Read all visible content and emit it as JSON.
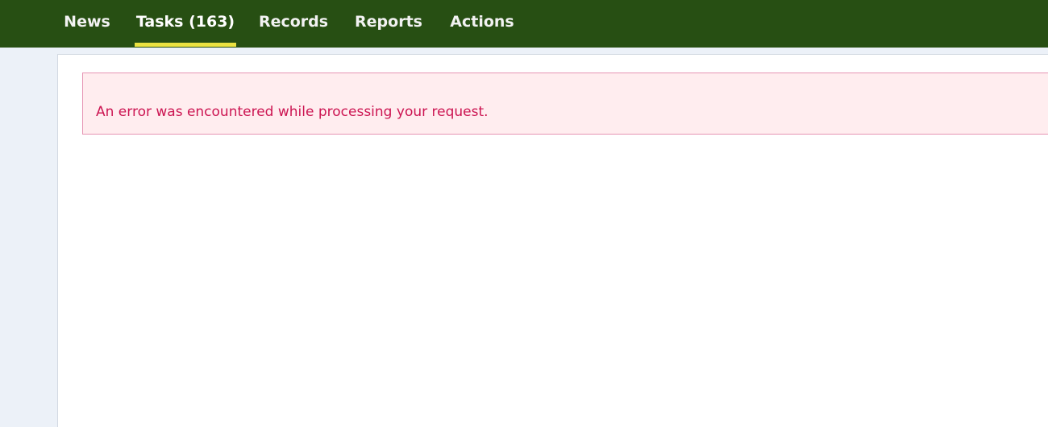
{
  "nav": {
    "items": [
      {
        "label": "News",
        "active": false
      },
      {
        "label": "Tasks (163)",
        "active": true
      },
      {
        "label": "Records",
        "active": false
      },
      {
        "label": "Reports",
        "active": false
      },
      {
        "label": "Actions",
        "active": false
      }
    ]
  },
  "alert": {
    "type": "error",
    "message": "An error was encountered while processing your request."
  },
  "colors": {
    "nav_background": "#274f13",
    "active_underline": "#ebe241",
    "page_background": "#ecf1f8",
    "alert_background": "#ffedef",
    "alert_border": "#e695b4",
    "alert_text": "#cc1552"
  }
}
